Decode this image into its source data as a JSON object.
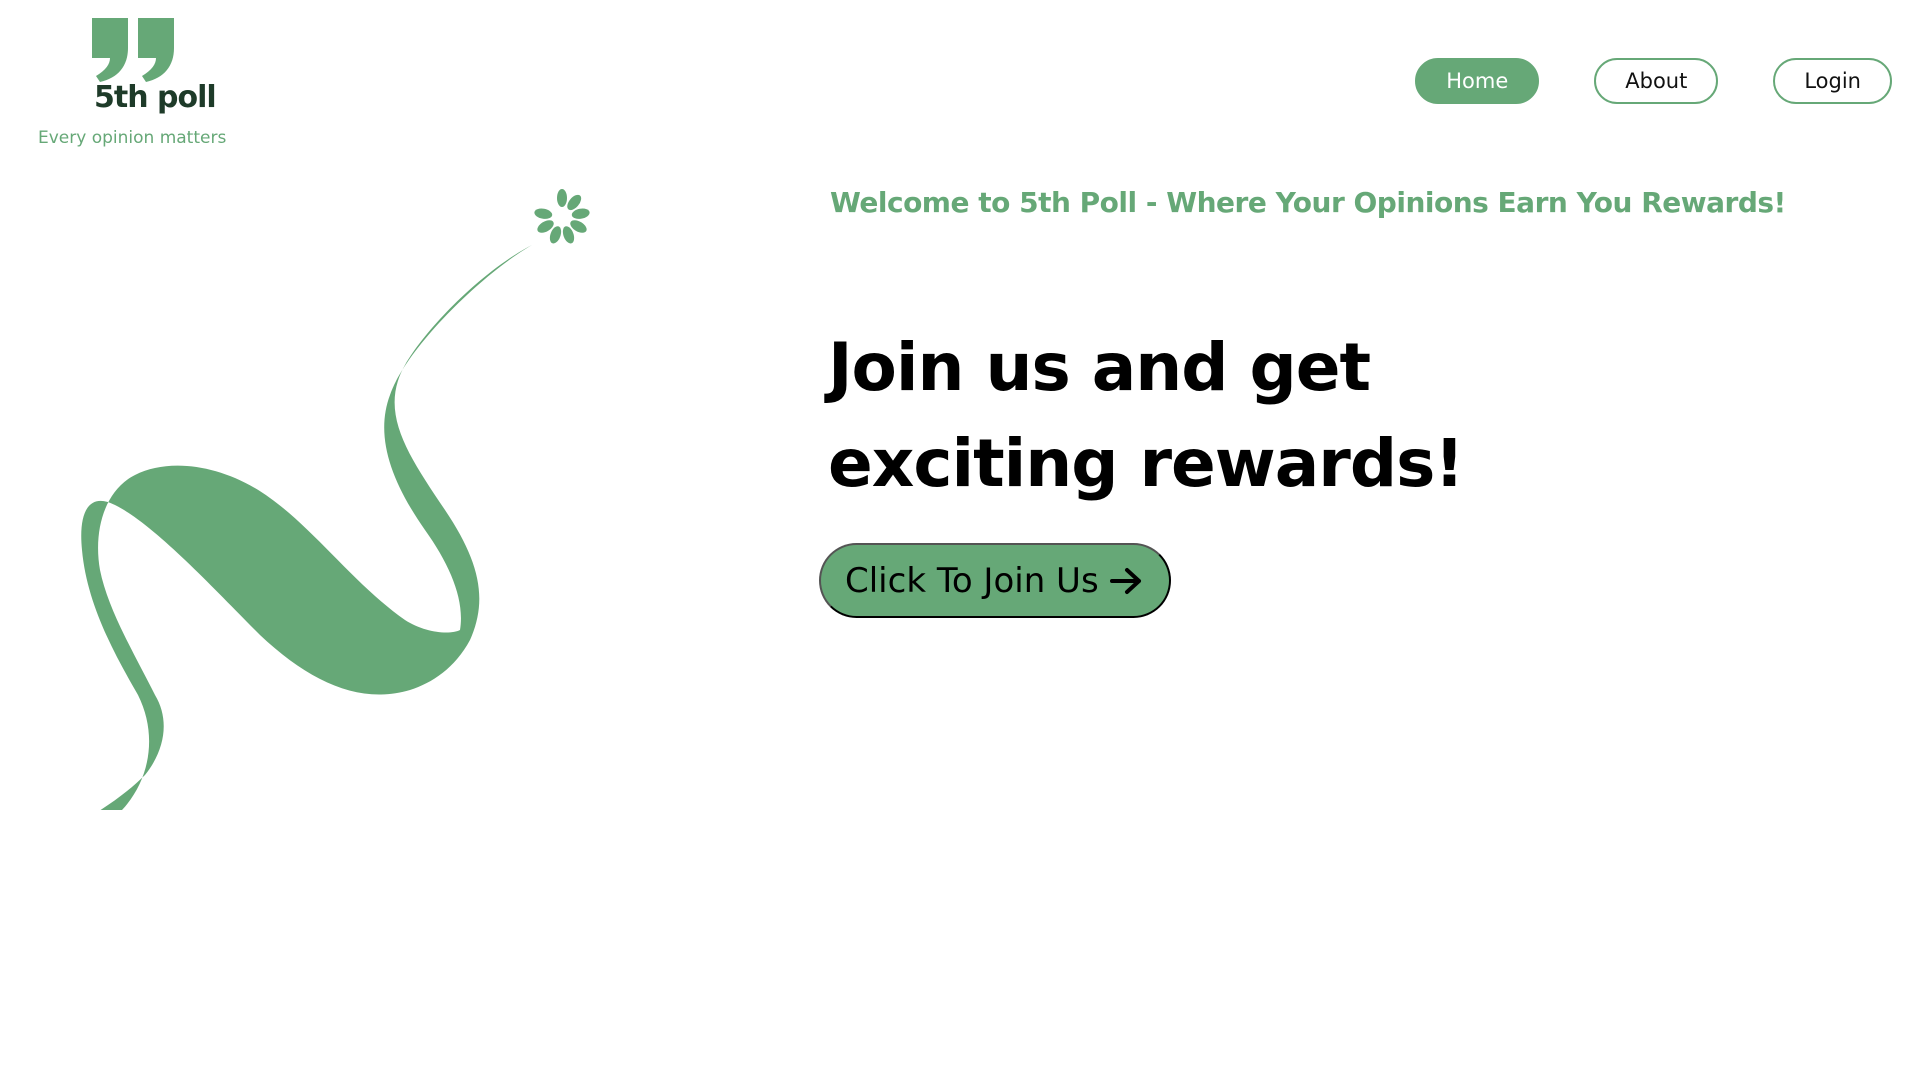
{
  "brand": {
    "name": "5th poll",
    "tagline": "Every opinion matters",
    "logo_icon": "quote-marks-icon",
    "accent_color": "#66a877",
    "dark_color": "#1e3b29"
  },
  "nav": {
    "items": [
      {
        "label": "Home",
        "active": true
      },
      {
        "label": "About",
        "active": false
      },
      {
        "label": "Login",
        "active": false
      }
    ]
  },
  "hero": {
    "welcome": "Welcome to 5th Poll - Where Your Opinions Earn You Rewards!",
    "headline_line1": "Join us and get",
    "headline_line2": "exciting rewards!",
    "cta_label": "Click To Join Us",
    "cta_icon": "arrow-right-icon",
    "illustration_icon": "ribbon-flower-illustration"
  }
}
